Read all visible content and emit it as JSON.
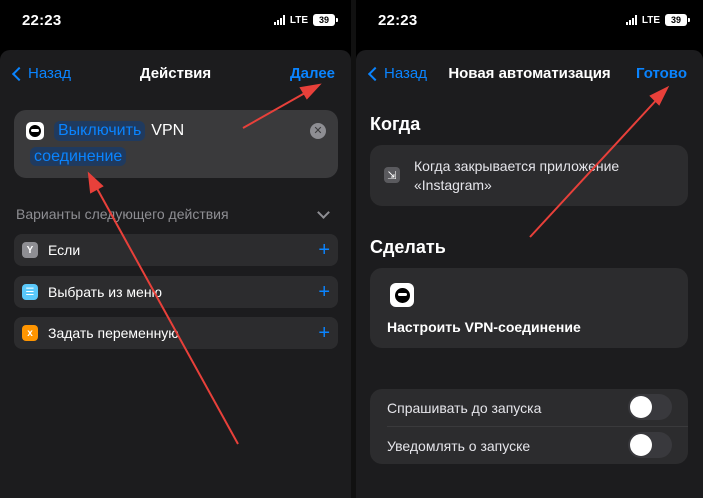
{
  "status": {
    "time": "22:23",
    "network": "LTE",
    "battery": "39"
  },
  "left": {
    "back_label": "Назад",
    "title": "Действия",
    "next_label": "Далее",
    "action": {
      "verb": "Выключить",
      "word": "VPN",
      "object": "соединение"
    },
    "next_actions_header": "Варианты следующего действия",
    "options": [
      {
        "label": "Если",
        "icon": "branch-icon",
        "color": "#8e8e93",
        "glyph": "Y"
      },
      {
        "label": "Выбрать из меню",
        "icon": "menu-icon",
        "color": "#5ac8fa",
        "glyph": "☰"
      },
      {
        "label": "Задать переменную",
        "icon": "variable-icon",
        "color": "#ff9500",
        "glyph": "x"
      }
    ]
  },
  "right": {
    "back_label": "Назад",
    "title": "Новая автоматизация",
    "done_label": "Готово",
    "when_header": "Когда",
    "when_text": "Когда закрывается приложение «Instagram»",
    "do_header": "Сделать",
    "do_text": "Настроить VPN-соединение",
    "ask_label": "Спрашивать до запуска",
    "notify_label": "Уведомлять о запуске"
  },
  "colors": {
    "accent": "#0a84ff",
    "annotation": "#e8403a"
  }
}
